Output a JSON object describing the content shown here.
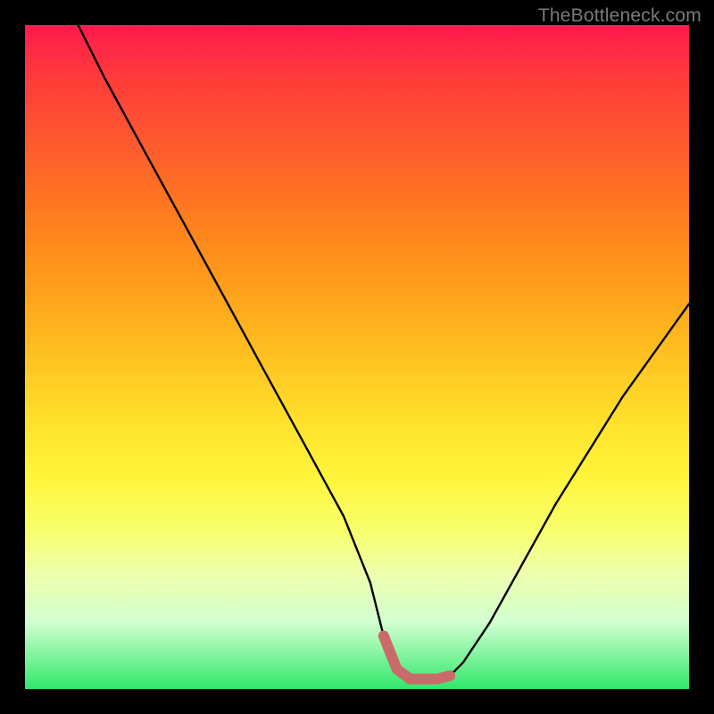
{
  "watermark": "TheBottleneck.com",
  "colors": {
    "frame": "#000000",
    "gradient_top": "#ff1a4d",
    "gradient_bottom": "#30e86a",
    "curve": "#000000",
    "highlight": "#cb6a6a"
  },
  "chart_data": {
    "type": "line",
    "title": "",
    "xlabel": "",
    "ylabel": "",
    "xlim": [
      0,
      100
    ],
    "ylim": [
      0,
      100
    ],
    "grid": false,
    "series": [
      {
        "name": "curve",
        "x": [
          8,
          12,
          18,
          24,
          30,
          36,
          42,
          48,
          52,
          54,
          56,
          58,
          60,
          62,
          64,
          66,
          70,
          75,
          80,
          85,
          90,
          95,
          100
        ],
        "values": [
          100,
          92,
          81,
          70,
          59,
          48,
          37,
          26,
          16,
          8,
          3,
          1.5,
          1.5,
          1.5,
          2,
          4,
          10,
          19,
          28,
          36,
          44,
          51,
          58
        ]
      }
    ],
    "highlight_segment": {
      "x_start": 53,
      "x_end": 65,
      "note": "thick salmon region at curve minimum"
    }
  }
}
